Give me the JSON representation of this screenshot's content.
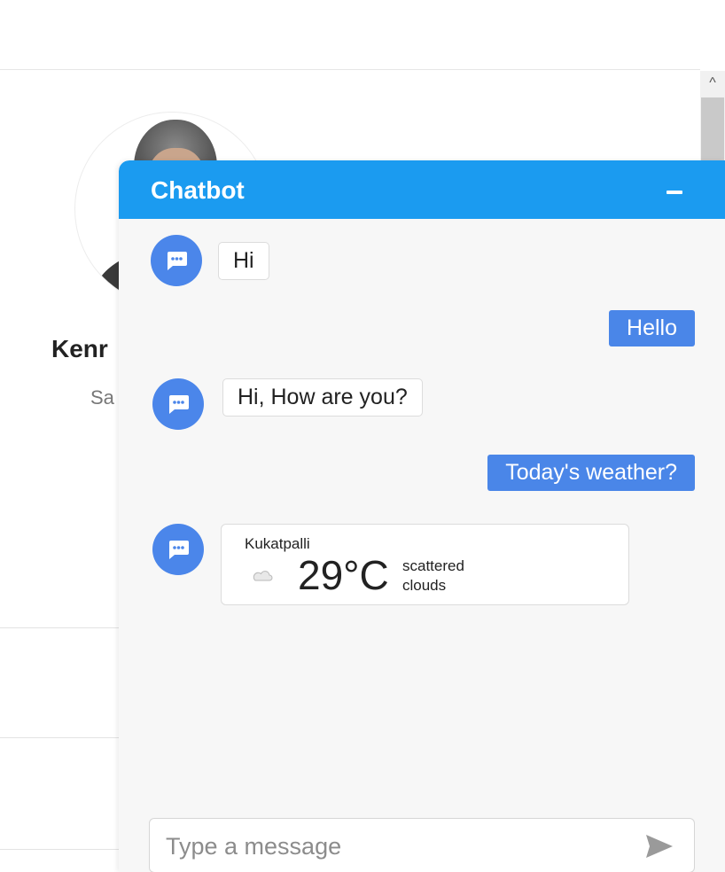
{
  "profile": {
    "name": "Kenr",
    "role": "Sa"
  },
  "chatbot": {
    "title": "Chatbot",
    "header_color": "#1b9bf0",
    "bot_avatar_icon": "chat-bubble-icon",
    "user_bubble_color": "#4a86e8",
    "messages": [
      {
        "sender": "bot",
        "text": "Hi"
      },
      {
        "sender": "user",
        "text": "Hello"
      },
      {
        "sender": "bot",
        "text": "Hi, How are you?"
      },
      {
        "sender": "user",
        "text": "Today's weather?"
      },
      {
        "sender": "bot",
        "type": "weather"
      }
    ],
    "weather": {
      "city": "Kukatpalli",
      "temperature": "29°C",
      "description": "scattered clouds",
      "icon": "cloud-icon"
    },
    "input": {
      "placeholder": "Type a message",
      "value": ""
    }
  }
}
